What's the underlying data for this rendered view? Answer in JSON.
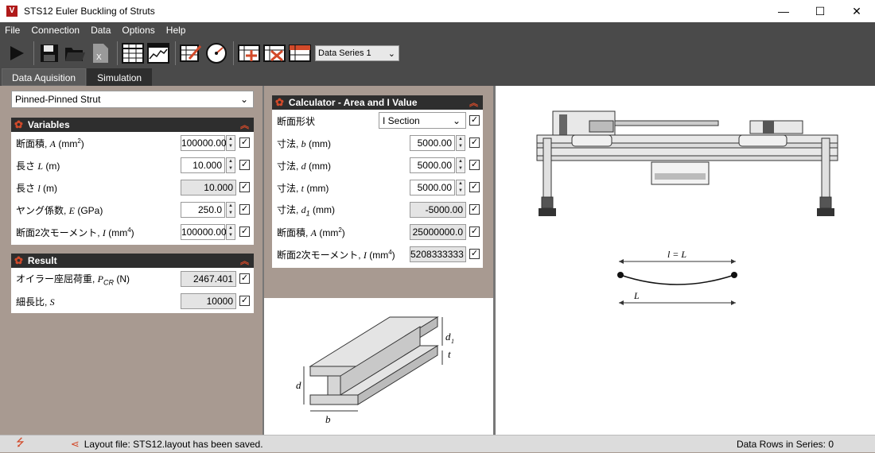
{
  "window": {
    "title": "STS12 Euler Buckling of Struts",
    "icon": "V"
  },
  "window_controls": {
    "minimize": "—",
    "maximize": "☐",
    "close": "✕"
  },
  "menu": {
    "file": "File",
    "connection": "Connection",
    "data": "Data",
    "options": "Options",
    "help": "Help"
  },
  "toolbar": {
    "data_series_value": "Data Series 1"
  },
  "tabs": {
    "data_acquisition": "Data Aquisition",
    "simulation": "Simulation"
  },
  "strut_type": "Pinned-Pinned Strut",
  "variables": {
    "title": "Variables",
    "rows": [
      {
        "label": "断面積, ",
        "sym": "A",
        "unit": " (mm",
        "sup": "2",
        "unit_end": ")",
        "value": "100000.00"
      },
      {
        "label": "長さ ",
        "sym": "L",
        "unit": " (m)",
        "sup": "",
        "unit_end": "",
        "value": "10.000"
      },
      {
        "label": "長さ ",
        "sym": "l",
        "unit": " (m)",
        "sup": "",
        "unit_end": "",
        "value": "10.000"
      },
      {
        "label": "ヤング係数, ",
        "sym": "E",
        "unit": " (GPa)",
        "sup": "",
        "unit_end": "",
        "value": "250.0"
      },
      {
        "label": "断面2次モーメント, ",
        "sym": "I",
        "unit": " (mm",
        "sup": "4",
        "unit_end": ")",
        "value": "100000.00"
      }
    ]
  },
  "result": {
    "title": "Result",
    "rows": [
      {
        "label": "オイラー座屈荷重, ",
        "sym": "P",
        "sub": "CR",
        "unit": " (N)",
        "value": "2467.401"
      },
      {
        "label": "細長比, ",
        "sym": "S",
        "sub": "",
        "unit": "",
        "value": "10000"
      }
    ]
  },
  "calculator": {
    "title": "Calculator - Area and I Value",
    "section_label": "断面形状",
    "section_value": "I Section",
    "rows": [
      {
        "label": "寸法, ",
        "sym": "b",
        "sub": "",
        "unit": " (mm)",
        "sup": "",
        "unit_end": "",
        "value": "5000.00"
      },
      {
        "label": "寸法, ",
        "sym": "d",
        "sub": "",
        "unit": " (mm)",
        "sup": "",
        "unit_end": "",
        "value": "5000.00"
      },
      {
        "label": "寸法, ",
        "sym": "t",
        "sub": "",
        "unit": " (mm)",
        "sup": "",
        "unit_end": "",
        "value": "5000.00"
      },
      {
        "label": "寸法, ",
        "sym": "d",
        "sub": "1",
        "unit": " (mm)",
        "sup": "",
        "unit_end": "",
        "value": "-5000.00"
      },
      {
        "label": "断面積, ",
        "sym": "A",
        "sub": "",
        "unit": " (mm",
        "sup": "2",
        "unit_end": ")",
        "value": "25000000.0"
      },
      {
        "label": "断面2次モーメント, ",
        "sym": "I",
        "sub": "",
        "unit": " (mm",
        "sup": "4",
        "unit_end": ")",
        "value": "5208333333"
      }
    ]
  },
  "ibeam_labels": {
    "d1": "d",
    "d1_sub": "1",
    "t": "t",
    "d": "d",
    "b": "b"
  },
  "strut_diagram": {
    "top_label": "l = L",
    "bottom_label": "L"
  },
  "status": {
    "layout_message": "Layout file: STS12.layout has been saved.",
    "rows_label": "Data Rows in Series: 0"
  },
  "colors": {
    "accent": "#d24a2a",
    "toolbar_bg": "#4a4a4a",
    "panel_head": "#2e2e2e",
    "bg": "#a89a91"
  }
}
